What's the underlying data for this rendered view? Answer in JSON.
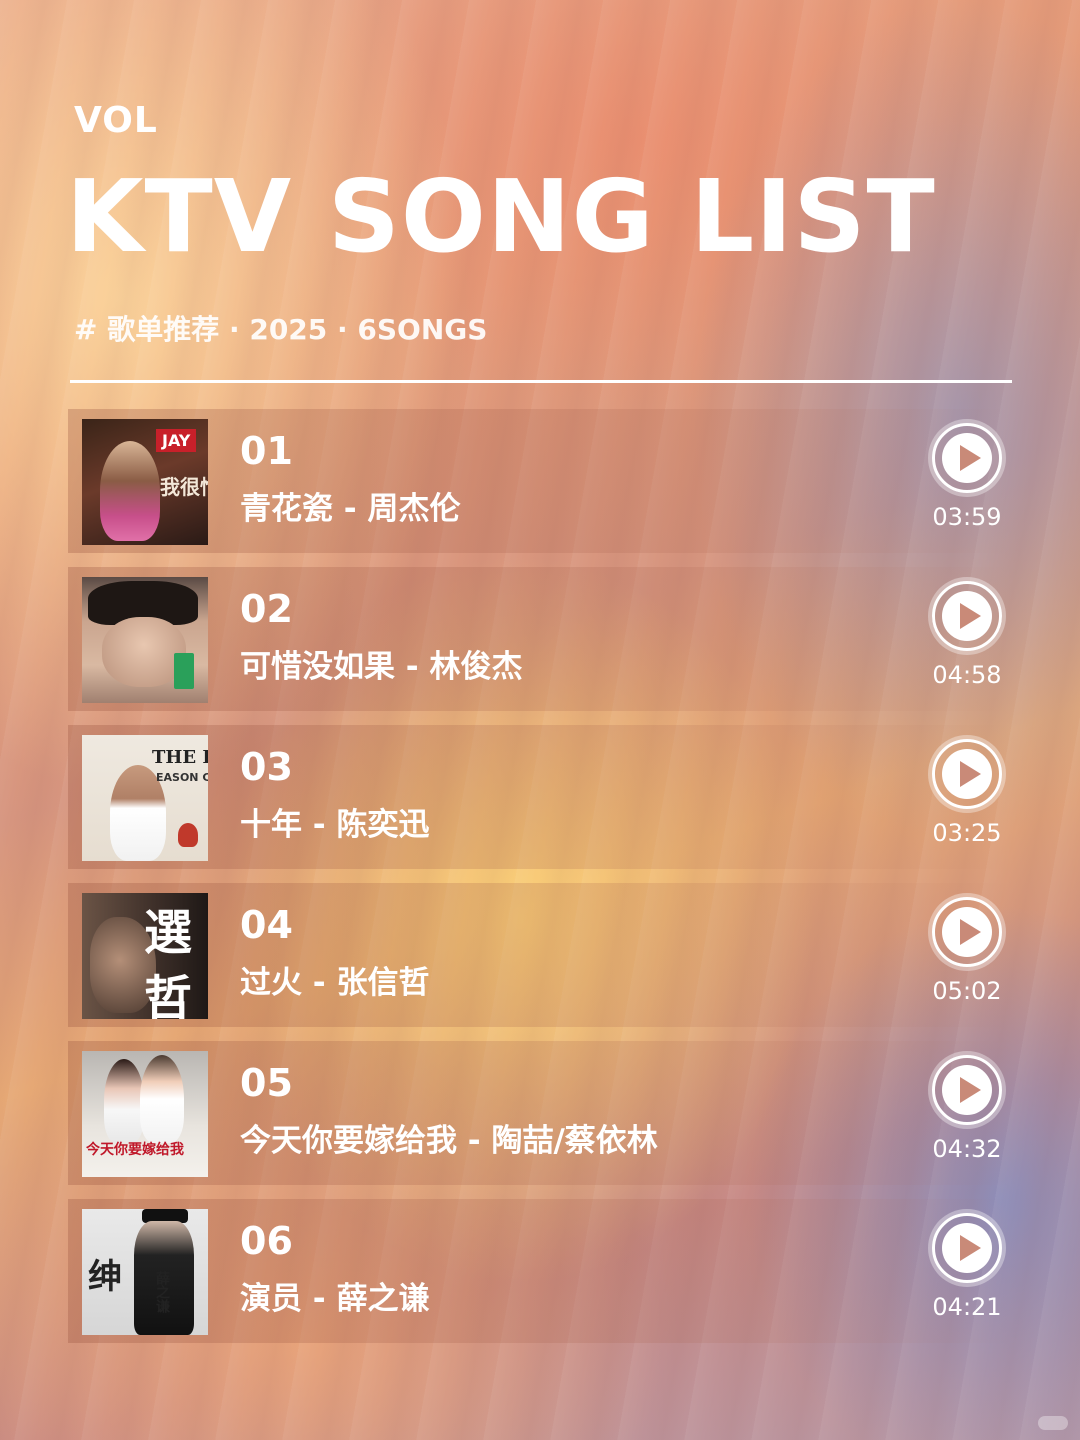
{
  "header": {
    "vol": "VOL",
    "title": "KTV SONG LIST",
    "subtitle": "# 歌单推荐 · 2025 · 6SONGS"
  },
  "songs": [
    {
      "number": "01",
      "title": "青花瓷 - 周杰伦",
      "duration": "03:59",
      "cover_text": "JAY"
    },
    {
      "number": "02",
      "title": "可惜没如果 - 林俊杰",
      "duration": "04:58",
      "cover_text": ""
    },
    {
      "number": "03",
      "title": "十年 - 陈奕迅",
      "duration": "03:25",
      "cover_text": "THE LINE EASON CH"
    },
    {
      "number": "04",
      "title": "过火 - 张信哲",
      "duration": "05:02",
      "cover_text": "選 哲"
    },
    {
      "number": "05",
      "title": "今天你要嫁给我 - 陶喆/蔡依林",
      "duration": "04:32",
      "cover_text": "今天你要嫁给我"
    },
    {
      "number": "06",
      "title": "演员 - 薛之谦",
      "duration": "04:21",
      "cover_text": "绅士 薛之谦"
    }
  ],
  "colors": {
    "text": "#ffffff",
    "play_triangle": "#c98a78",
    "background_warm": "#e49a78",
    "background_cool": "#b79aa8"
  },
  "icons": {
    "play": "play-circle-icon"
  }
}
